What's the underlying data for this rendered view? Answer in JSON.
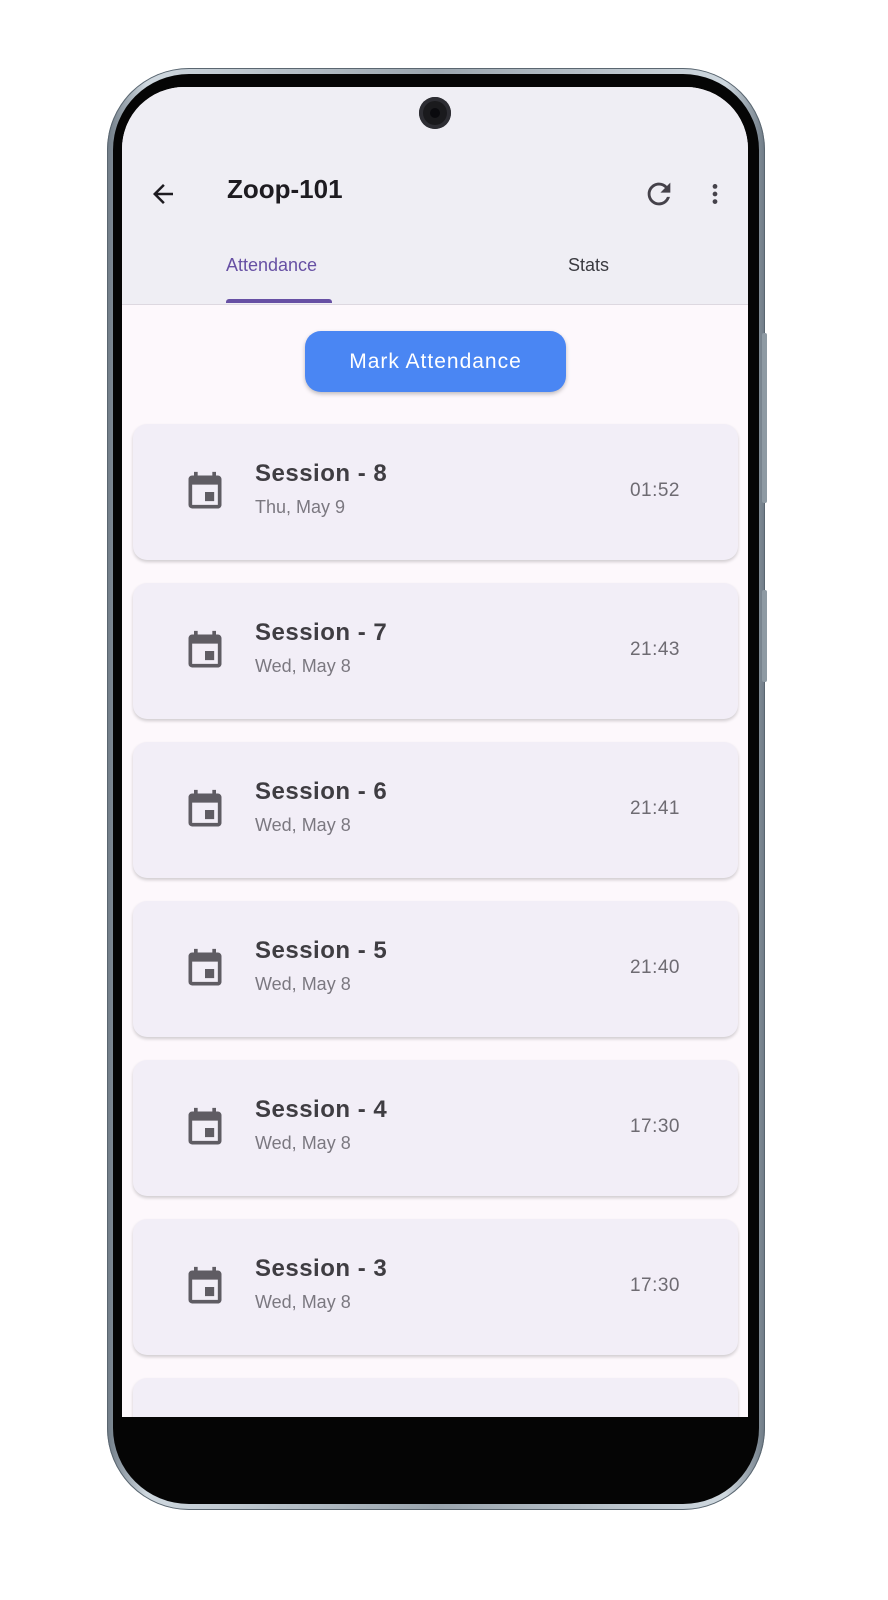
{
  "app_bar": {
    "title": "Zoop-101"
  },
  "tabs": [
    {
      "label": "Attendance",
      "selected": true
    },
    {
      "label": "Stats",
      "selected": false
    }
  ],
  "actions": {
    "mark_attendance_label": "Mark Attendance"
  },
  "colors": {
    "accent": "#6750a4",
    "button": "#4a86f3",
    "card": "#f2eef7"
  },
  "sessions": [
    {
      "name": "Session - 8",
      "date": "Thu, May 9",
      "time": "01:52",
      "icon": "calendar-icon"
    },
    {
      "name": "Session - 7",
      "date": "Wed, May 8",
      "time": "21:43",
      "icon": "calendar-icon"
    },
    {
      "name": "Session - 6",
      "date": "Wed, May 8",
      "time": "21:41",
      "icon": "calendar-icon"
    },
    {
      "name": "Session - 5",
      "date": "Wed, May 8",
      "time": "21:40",
      "icon": "calendar-icon"
    },
    {
      "name": "Session - 4",
      "date": "Wed, May 8",
      "time": "17:30",
      "icon": "calendar-icon"
    },
    {
      "name": "Session - 3",
      "date": "Wed, May 8",
      "time": "17:30",
      "icon": "calendar-icon"
    }
  ]
}
